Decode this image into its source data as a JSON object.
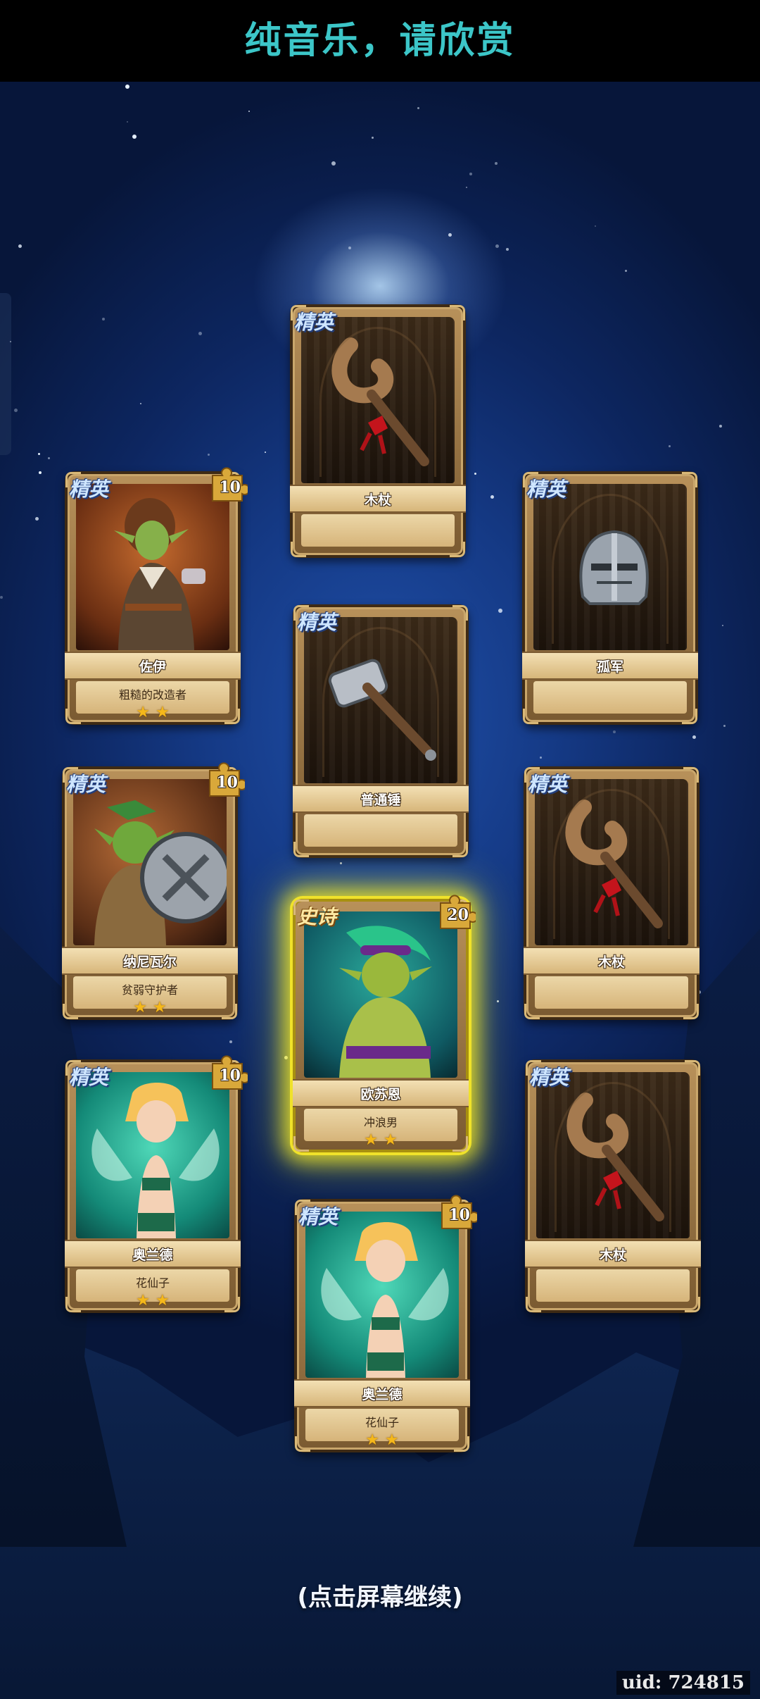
{
  "header": {
    "title": "纯音乐，请欣赏"
  },
  "colors": {
    "title": "#3cc6c8",
    "epic_glow": "#f0e22a",
    "star": "#f5b81a"
  },
  "cards": [
    {
      "id": "staff-top",
      "rarity": "精英",
      "name": "木杖",
      "kind": "item",
      "icon": "wooden-staff-icon"
    },
    {
      "id": "goblin-girl",
      "rarity": "精英",
      "name": "佐伊",
      "title": "粗糙的改造者",
      "stars": 2,
      "shards": "10",
      "kind": "hero",
      "icon": "goblin-tinkerer-portrait"
    },
    {
      "id": "helmet",
      "rarity": "精英",
      "name": "孤军",
      "kind": "item",
      "icon": "iron-helmet-icon"
    },
    {
      "id": "hammer",
      "rarity": "精英",
      "name": "普通锤",
      "kind": "item",
      "icon": "war-hammer-icon"
    },
    {
      "id": "goblin-shield",
      "rarity": "精英",
      "name": "纳尼瓦尔",
      "title": "贫弱守护者",
      "stars": 2,
      "shards": "10",
      "kind": "hero",
      "icon": "goblin-guardian-portrait"
    },
    {
      "id": "staff-right-mid",
      "rarity": "精英",
      "name": "木杖",
      "kind": "item",
      "icon": "wooden-staff-icon"
    },
    {
      "id": "surfer",
      "rarity": "史诗",
      "name": "欧苏恩",
      "title": "冲浪男",
      "stars": 2,
      "shards": "20",
      "kind": "hero",
      "epic": true,
      "icon": "troll-surfer-portrait"
    },
    {
      "id": "fairy-left",
      "rarity": "精英",
      "name": "奥兰德",
      "title": "花仙子",
      "stars": 2,
      "shards": "10",
      "kind": "hero",
      "icon": "flower-fairy-portrait"
    },
    {
      "id": "staff-right-low",
      "rarity": "精英",
      "name": "木杖",
      "kind": "item",
      "icon": "wooden-staff-icon"
    },
    {
      "id": "fairy-bottom",
      "rarity": "精英",
      "name": "奥兰德",
      "title": "花仙子",
      "stars": 2,
      "shards": "10",
      "kind": "hero",
      "icon": "flower-fairy-portrait"
    }
  ],
  "footer": {
    "continue_text": "(点击屏幕继续)",
    "uid": "uid: 724815"
  }
}
